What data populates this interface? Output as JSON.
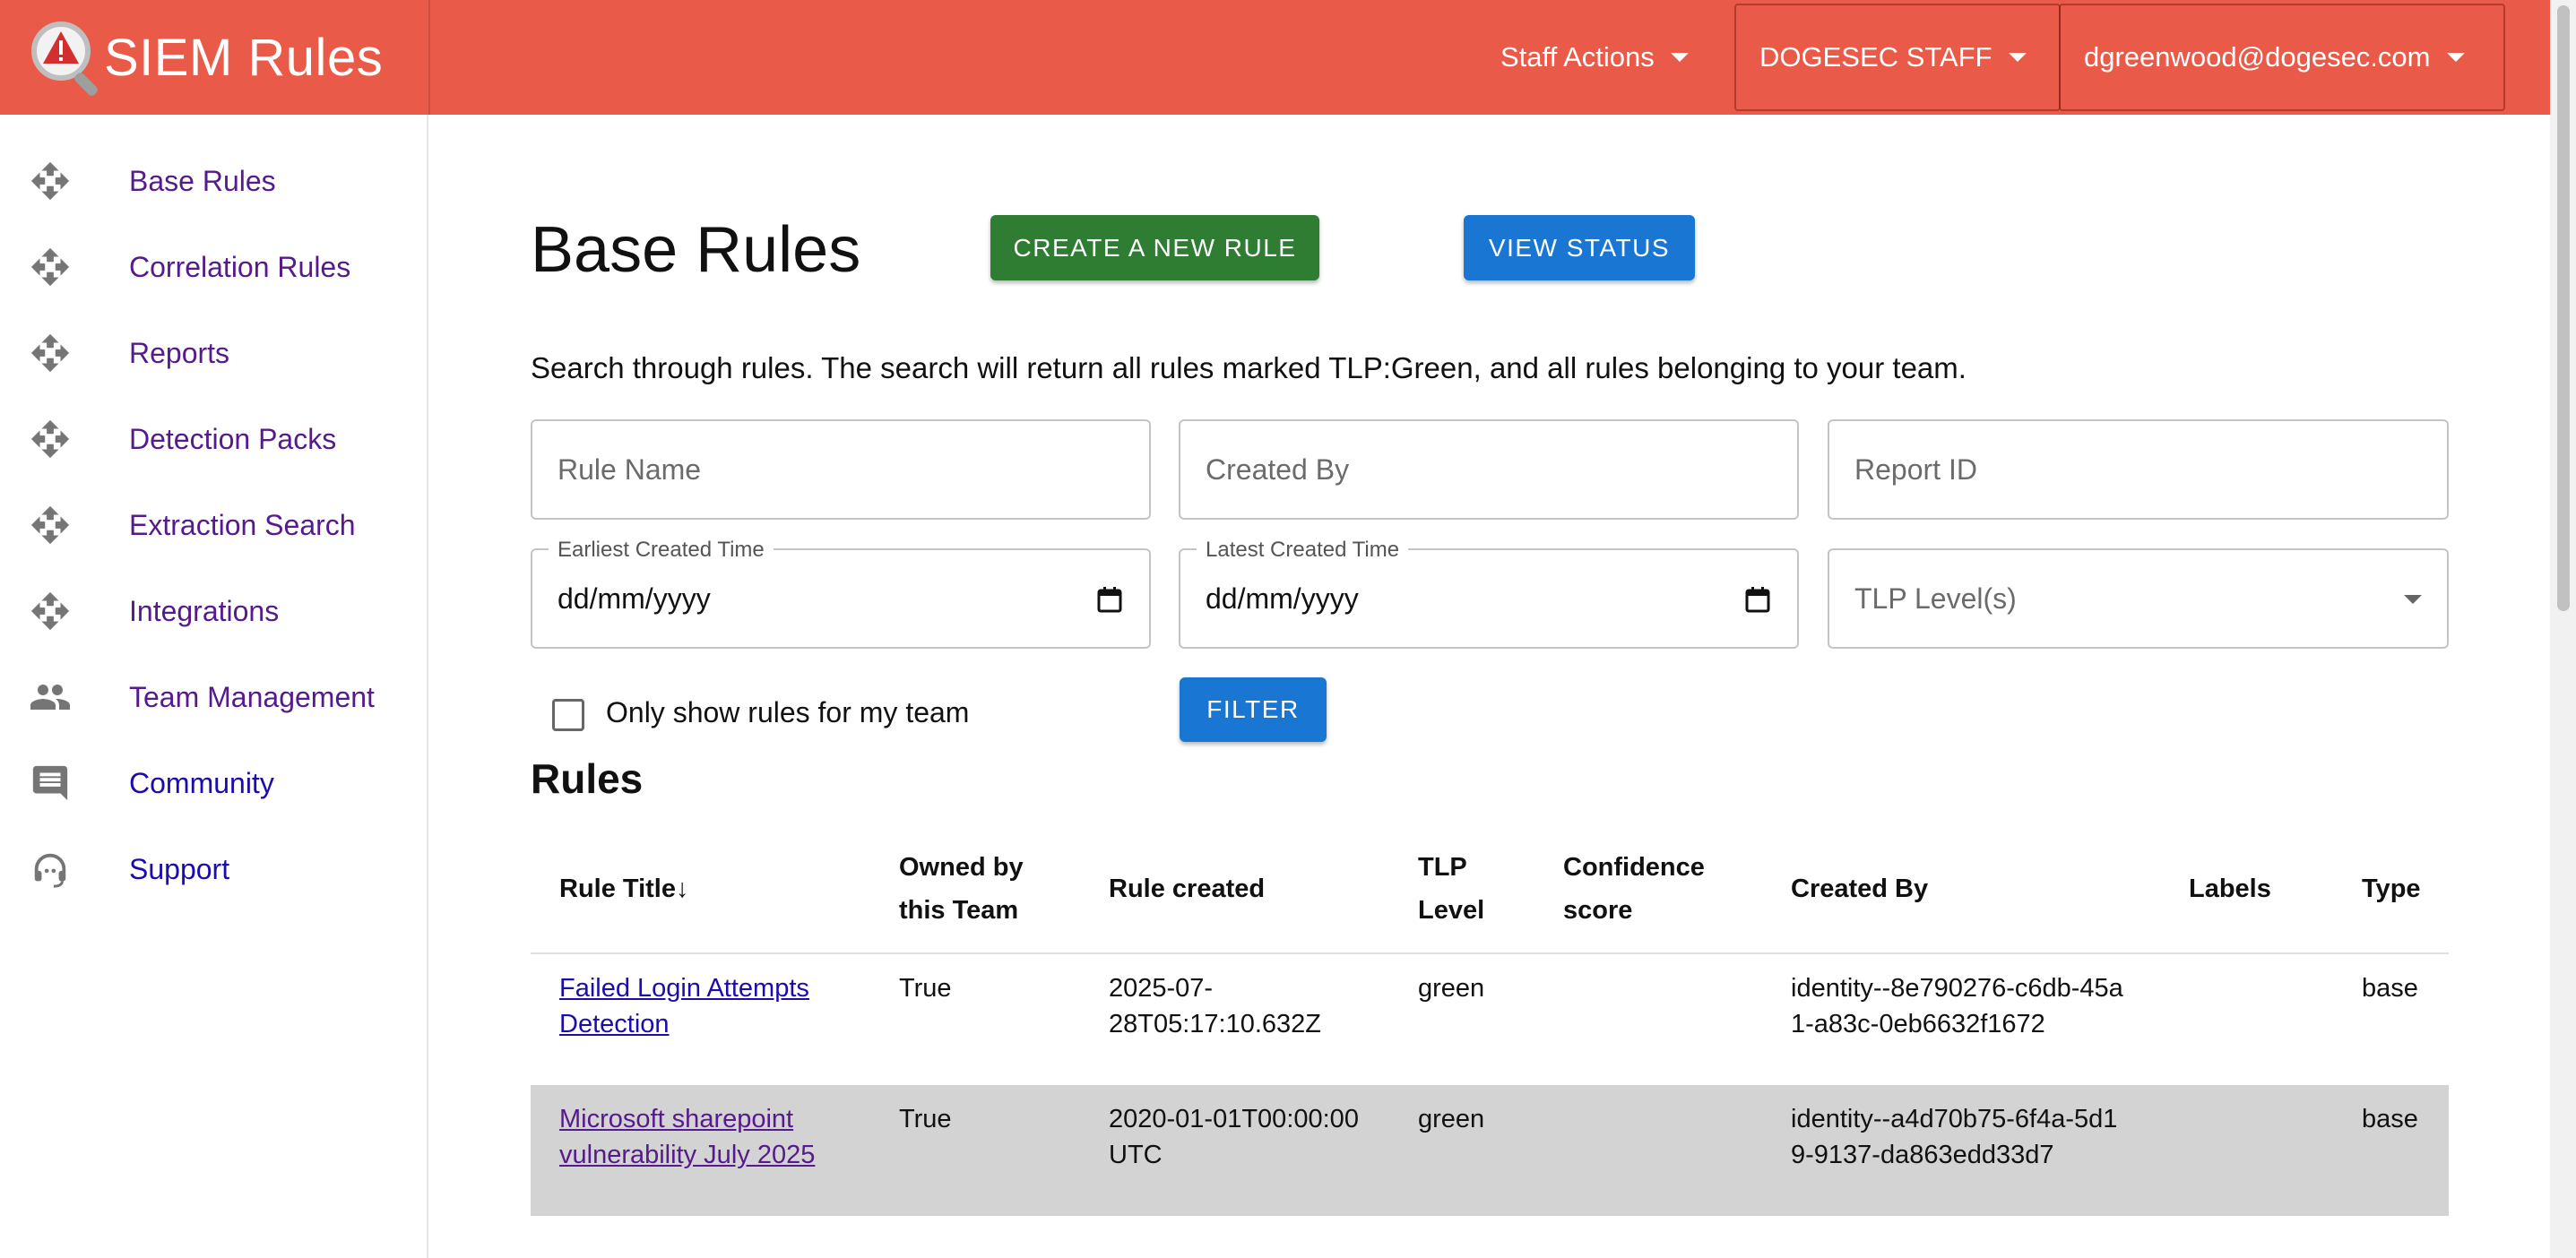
{
  "app": {
    "title": "SIEM Rules",
    "brand_color": "#e95a48"
  },
  "topbar": {
    "staff_actions": "Staff Actions",
    "org": "DOGESEC STAFF",
    "user": "dgreenwood@dogesec.com"
  },
  "sidebar": {
    "items": [
      {
        "label": "Base Rules",
        "icon": "move-arrows-icon"
      },
      {
        "label": "Correlation Rules",
        "icon": "move-arrows-icon"
      },
      {
        "label": "Reports",
        "icon": "move-arrows-icon"
      },
      {
        "label": "Detection Packs",
        "icon": "move-arrows-icon"
      },
      {
        "label": "Extraction Search",
        "icon": "move-arrows-icon"
      },
      {
        "label": "Integrations",
        "icon": "move-arrows-icon"
      },
      {
        "label": "Team Management",
        "icon": "people-icon"
      },
      {
        "label": "Community",
        "icon": "comment-icon"
      },
      {
        "label": "Support",
        "icon": "support-agent-icon"
      }
    ]
  },
  "main": {
    "title": "Base Rules",
    "create_button": "CREATE A NEW RULE",
    "status_button": "VIEW STATUS",
    "intro": "Search through rules. The search will return all rules marked TLP:Green, and all rules belonging to your team.",
    "filters": {
      "rule_name_placeholder": "Rule Name",
      "created_by_placeholder": "Created By",
      "report_id_placeholder": "Report ID",
      "earliest_label": "Earliest Created Time",
      "earliest_value": "dd/mm/yyyy",
      "latest_label": "Latest Created Time",
      "latest_value": "dd/mm/yyyy",
      "tlp_placeholder": "TLP Level(s)",
      "team_only_label": "Only show rules for my team",
      "filter_button": "FILTER"
    },
    "rules_title": "Rules",
    "table": {
      "headers": {
        "title": "Rule Title↓",
        "owned": "Owned by this Team",
        "created": "Rule created",
        "tlp": "TLP Level",
        "confidence": "Confidence score",
        "created_by": "Created By",
        "labels": "Labels",
        "type": "Type"
      },
      "rows": [
        {
          "title": "Failed Login Attempts Detection",
          "owned": "True",
          "created": "2025-07-28T05:17:10.632Z",
          "tlp": "green",
          "confidence": "",
          "created_by": "identity--8e790276-c6db-45a1-a83c-0eb6632f1672",
          "labels": "",
          "type": "base"
        },
        {
          "title": "Microsoft sharepoint vulnerability July 2025",
          "owned": "True",
          "created": "2020-01-01T00:00:00 UTC",
          "tlp": "green",
          "confidence": "",
          "created_by": "identity--a4d70b75-6f4a-5d19-9137-da863edd33d7",
          "labels": "",
          "type": "base"
        }
      ]
    }
  }
}
